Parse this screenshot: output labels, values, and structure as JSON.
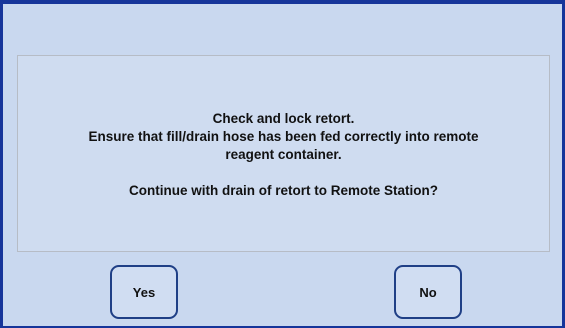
{
  "dialog": {
    "message": {
      "line1": "Check and lock retort.",
      "line2": "Ensure that fill/drain hose has been fed correctly into remote",
      "line3": "reagent container.",
      "line4": "Continue with drain of retort to Remote Station?"
    },
    "buttons": {
      "yes_label": "Yes",
      "no_label": "No"
    }
  },
  "colors": {
    "frame": "#16359a",
    "background": "#c9d8ef",
    "button_border": "#1f3f86"
  }
}
